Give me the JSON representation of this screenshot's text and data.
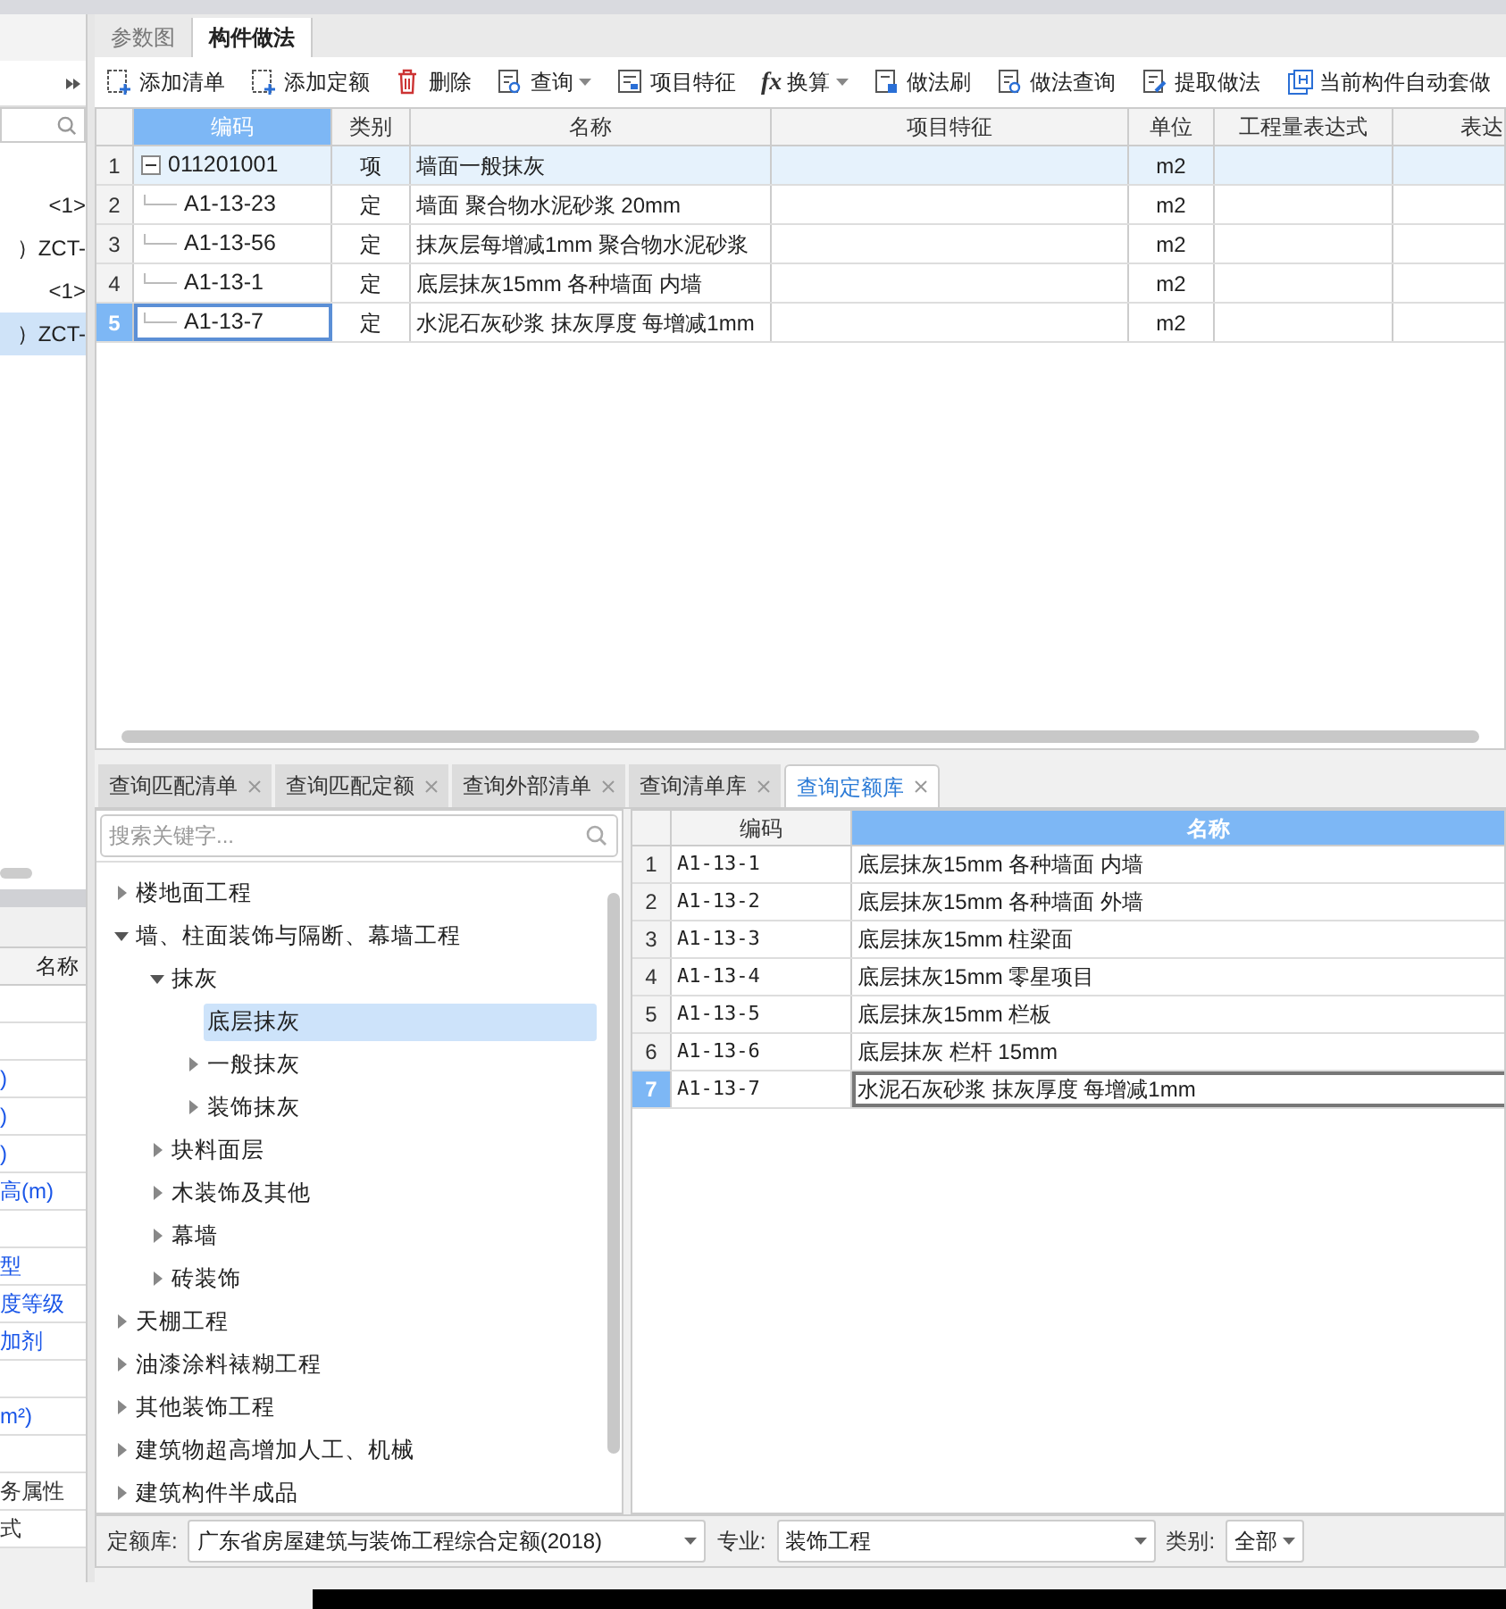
{
  "left_panel": {
    "items": [
      {
        "text": "<1>",
        "selected": false
      },
      {
        "text": "）ZCT-",
        "selected": false
      },
      {
        "text": "<1>",
        "selected": false
      },
      {
        "text": "）ZCT-",
        "selected": true
      }
    ],
    "properties": {
      "header": "名称",
      "rows": [
        {},
        {},
        {
          "text": ")"
        },
        {
          "text": ")"
        },
        {
          "text": ")"
        },
        {
          "text": "高(m)"
        },
        {},
        {
          "text": "型"
        },
        {
          "text": "度等级"
        },
        {
          "text": "加剂"
        },
        {},
        {
          "text": "m²)"
        },
        {},
        {
          "text": "务属性",
          "kind": "plain"
        },
        {
          "text": "式",
          "kind": "plain"
        }
      ]
    }
  },
  "tabs": [
    {
      "label": "参数图",
      "selected": false
    },
    {
      "label": "构件做法",
      "selected": true
    }
  ],
  "toolbar": [
    {
      "label": "添加清单",
      "kind": "add",
      "dropdown": false
    },
    {
      "label": "添加定额",
      "kind": "add",
      "dropdown": false
    },
    {
      "label": "删除",
      "kind": "delete",
      "dropdown": false
    },
    {
      "label": "查询",
      "kind": "query",
      "dropdown": true
    },
    {
      "label": "项目特征",
      "kind": "feature",
      "dropdown": false
    },
    {
      "label": "换算",
      "kind": "formula",
      "icon_text": "fx",
      "dropdown": true
    },
    {
      "label": "做法刷",
      "kind": "brush",
      "dropdown": false
    },
    {
      "label": "做法查询",
      "kind": "query",
      "dropdown": false
    },
    {
      "label": "提取做法",
      "kind": "extract",
      "dropdown": false
    },
    {
      "label": "当前构件自动套做",
      "kind": "auto",
      "dropdown": false
    }
  ],
  "table": {
    "columns": [
      {
        "label": "编码",
        "selected": true
      },
      {
        "label": "类别",
        "selected": false
      },
      {
        "label": "名称",
        "selected": false
      },
      {
        "label": "项目特征",
        "selected": false
      },
      {
        "label": "单位",
        "selected": false
      },
      {
        "label": "工程量表达式",
        "selected": false
      },
      {
        "label": "表达",
        "selected": false
      }
    ],
    "rows": [
      {
        "num": "1",
        "code": "011201001",
        "type": "项",
        "name": "墙面一般抹灰",
        "unit": "m2",
        "selected": false,
        "highlighted": true,
        "expanded": true,
        "children": [
          {
            "num": "2",
            "code": "A1-13-23",
            "type": "定",
            "name": "墙面 聚合物水泥砂浆 20mm",
            "unit": "m2",
            "selected": false,
            "highlighted": false
          },
          {
            "num": "3",
            "code": "A1-13-56",
            "type": "定",
            "name": "抹灰层每增减1mm 聚合物水泥砂浆",
            "unit": "m2",
            "selected": false,
            "highlighted": false
          },
          {
            "num": "4",
            "code": "A1-13-1",
            "type": "定",
            "name": "底层抹灰15mm 各种墙面 内墙",
            "unit": "m2",
            "selected": false,
            "highlighted": false
          },
          {
            "num": "5",
            "code": "A1-13-7",
            "type": "定",
            "name": "水泥石灰砂浆 抹灰厚度 每增减1mm",
            "unit": "m2",
            "selected": true,
            "highlighted": false
          }
        ]
      }
    ]
  },
  "bottom_tabs": [
    {
      "label": "查询匹配清单",
      "selected": false
    },
    {
      "label": "查询匹配定额",
      "selected": false
    },
    {
      "label": "查询外部清单",
      "selected": false
    },
    {
      "label": "查询清单库",
      "selected": false
    },
    {
      "label": "查询定额库",
      "selected": true
    }
  ],
  "tree": {
    "search": {
      "placeholder": "搜索关键字..."
    },
    "items": [
      {
        "label": "楼地面工程",
        "kind": "branch",
        "expanded": false,
        "selected": false
      },
      {
        "label": "墙、柱面装饰与隔断、幕墙工程",
        "kind": "branch",
        "expanded": true,
        "selected": false,
        "children": [
          {
            "label": "抹灰",
            "kind": "branch",
            "expanded": true,
            "selected": false,
            "children": [
              {
                "label": "底层抹灰",
                "kind": "leaf",
                "selected": true
              },
              {
                "label": "一般抹灰",
                "kind": "branch",
                "expanded": false,
                "selected": false
              },
              {
                "label": "装饰抹灰",
                "kind": "branch",
                "expanded": false,
                "selected": false
              }
            ]
          },
          {
            "label": "块料面层",
            "kind": "branch",
            "expanded": false,
            "selected": false
          },
          {
            "label": "木装饰及其他",
            "kind": "branch",
            "expanded": false,
            "selected": false
          },
          {
            "label": "幕墙",
            "kind": "branch",
            "expanded": false,
            "selected": false
          },
          {
            "label": "砖装饰",
            "kind": "branch",
            "expanded": false,
            "selected": false
          }
        ]
      },
      {
        "label": "天棚工程",
        "kind": "branch",
        "expanded": false,
        "selected": false
      },
      {
        "label": "油漆涂料裱糊工程",
        "kind": "branch",
        "expanded": false,
        "selected": false
      },
      {
        "label": "其他装饰工程",
        "kind": "branch",
        "expanded": false,
        "selected": false
      },
      {
        "label": "建筑物超高增加人工、机械",
        "kind": "branch",
        "expanded": false,
        "selected": false
      },
      {
        "label": "建筑构件半成品",
        "kind": "branch",
        "expanded": false,
        "selected": false
      }
    ]
  },
  "quota_grid": {
    "columns": [
      {
        "label": "编码",
        "selected": false
      },
      {
        "label": "名称",
        "selected": true
      }
    ],
    "rows": [
      {
        "num": "1",
        "code": "A1-13-1",
        "name": "底层抹灰15mm 各种墙面 内墙",
        "selected": false
      },
      {
        "num": "2",
        "code": "A1-13-2",
        "name": "底层抹灰15mm 各种墙面 外墙",
        "selected": false
      },
      {
        "num": "3",
        "code": "A1-13-3",
        "name": "底层抹灰15mm 柱梁面",
        "selected": false
      },
      {
        "num": "4",
        "code": "A1-13-4",
        "name": "底层抹灰15mm 零星项目",
        "selected": false
      },
      {
        "num": "5",
        "code": "A1-13-5",
        "name": "底层抹灰15mm 栏板",
        "selected": false
      },
      {
        "num": "6",
        "code": "A1-13-6",
        "name": "底层抹灰 栏杆 15mm",
        "selected": false
      },
      {
        "num": "7",
        "code": "A1-13-7",
        "name": "水泥石灰砂浆 抹灰厚度 每增减1mm",
        "selected": true
      }
    ]
  },
  "footer": [
    {
      "label": "定额库:",
      "value": "广东省房屋建筑与装饰工程综合定额(2018)"
    },
    {
      "label": "专业:",
      "value": "装饰工程"
    },
    {
      "label": "类别:",
      "value": "全部"
    }
  ]
}
